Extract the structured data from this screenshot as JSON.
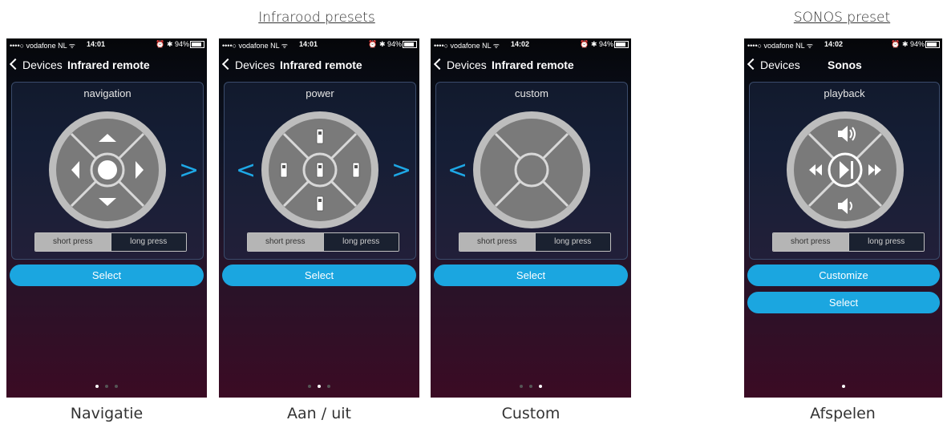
{
  "headings": {
    "infrared": "Infrarood presets",
    "sonos": "SONOS preset"
  },
  "phones": [
    {
      "status": {
        "carrier": "••••○ vodafone NL ᯤ",
        "time": "14:01",
        "right": "⏰ ✱ 94%"
      },
      "nav": {
        "back": "Devices",
        "title": "Infrared remote"
      },
      "panel_title": "navigation",
      "toggle": {
        "short": "short press",
        "long": "long press"
      },
      "buttons": [
        "Select"
      ],
      "caption": "Navigatie"
    },
    {
      "status": {
        "carrier": "••••○ vodafone NL ᯤ",
        "time": "14:01",
        "right": "⏰ ✱ 94%"
      },
      "nav": {
        "back": "Devices",
        "title": "Infrared remote"
      },
      "panel_title": "power",
      "toggle": {
        "short": "short press",
        "long": "long press"
      },
      "buttons": [
        "Select"
      ],
      "caption": "Aan / uit"
    },
    {
      "status": {
        "carrier": "••••○ vodafone NL ᯤ",
        "time": "14:02",
        "right": "⏰ ✱ 94%"
      },
      "nav": {
        "back": "Devices",
        "title": "Infrared remote"
      },
      "panel_title": "custom",
      "toggle": {
        "short": "short press",
        "long": "long press"
      },
      "buttons": [
        "Select"
      ],
      "caption": "Custom"
    },
    {
      "status": {
        "carrier": "••••○ vodafone NL ᯤ",
        "time": "14:02",
        "right": "⏰ ✱ 94%"
      },
      "nav": {
        "back": "Devices",
        "title": "Sonos"
      },
      "panel_title": "playback",
      "toggle": {
        "short": "short press",
        "long": "long press"
      },
      "buttons": [
        "Customize",
        "Select"
      ],
      "caption": "Afspelen"
    }
  ],
  "icons": {
    "phone1": "navigation-dpad",
    "phone2": "power-dpad",
    "phone3": "custom-dpad",
    "phone4": "playback-dpad"
  },
  "colors": {
    "accent": "#1ba6e0",
    "ring": "#bdbdbd",
    "center": "#777777"
  }
}
